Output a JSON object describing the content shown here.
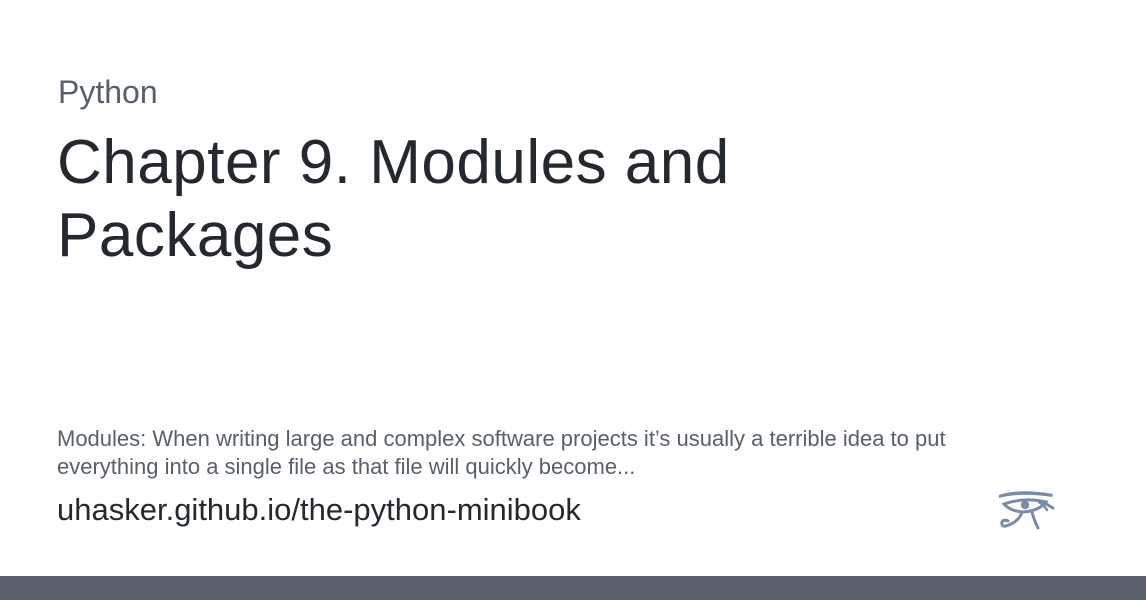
{
  "card": {
    "category": "Python",
    "title": "Chapter 9. Modules and Packages",
    "description": "Modules: When writing large and complex software projects it’s usually a terrible idea to put everything into a single file as that file will quickly become...",
    "url": "uhasker.github.io/the-python-minibook",
    "logo_icon": "eye-of-horus-icon"
  },
  "colors": {
    "background": "#ffffff",
    "title": "#24292f",
    "muted_text": "#57606a",
    "bottom_bar": "#5a616b",
    "logo": "#7b8aa8"
  }
}
